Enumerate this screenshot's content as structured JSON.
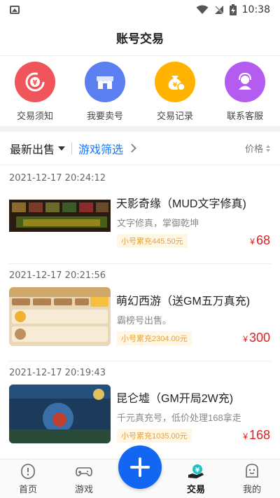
{
  "status_bar": {
    "time": "10:38"
  },
  "header": {
    "title": "账号交易"
  },
  "quick_actions": [
    {
      "label": "交易须知",
      "icon": "yuan-refresh-icon",
      "color": "#f0555c"
    },
    {
      "label": "我要卖号",
      "icon": "store-icon",
      "color": "#5b7ff0"
    },
    {
      "label": "交易记录",
      "icon": "money-bag-icon",
      "color": "#ffb300"
    },
    {
      "label": "联系客服",
      "icon": "customer-service-icon",
      "color": "#b45cf0"
    }
  ],
  "filters": {
    "latest": "最新出售",
    "game_filter": "游戏筛选",
    "price": "价格"
  },
  "listings": [
    {
      "time": "2021-12-17 20:24:12",
      "name": "天影奇缘（MUD文字修真)",
      "desc": "文字修真，掌御乾坤",
      "tag": "小号累充445.50元",
      "currency": "¥",
      "price": "68"
    },
    {
      "time": "2021-12-17 20:21:56",
      "name": "萌幻西游（送GM五万真充)",
      "desc": "霸榜号出售。",
      "tag": "小号累充2304.00元",
      "currency": "¥",
      "price": "300"
    },
    {
      "time": "2021-12-17 20:19:43",
      "name": "昆仑墟（GM开局2W充)",
      "desc": "千元真充号，低价处理168拿走",
      "tag": "小号累充1035.00元",
      "currency": "¥",
      "price": "168"
    }
  ],
  "bottom_nav": [
    {
      "label": "首页",
      "icon": "home-icon"
    },
    {
      "label": "游戏",
      "icon": "gamepad-icon"
    },
    {
      "label": "交易",
      "icon": "trade-icon"
    },
    {
      "label": "我的",
      "icon": "profile-icon"
    }
  ],
  "colors": {
    "accent": "#1677ff",
    "price": "#e02020",
    "tag_text": "#e6a23c",
    "fab": "#1266f1"
  }
}
